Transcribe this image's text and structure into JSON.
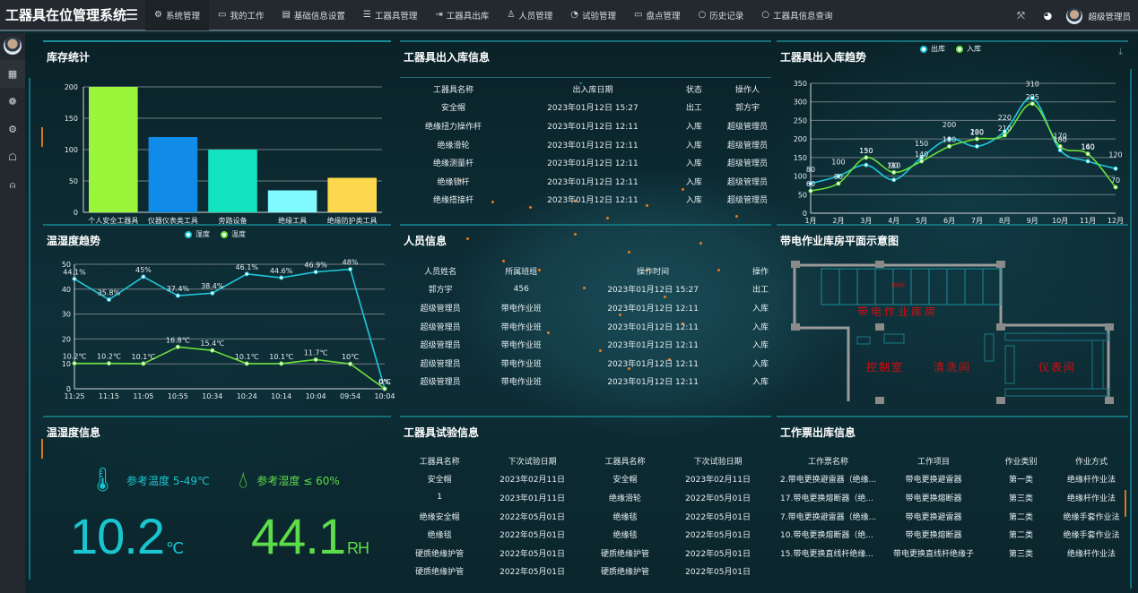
{
  "header": {
    "app_title": "工器具在位管理系统",
    "menu_icon": "hamburger-icon",
    "nav": [
      {
        "label": "系统管理",
        "icon": "gear-icon",
        "active": true
      },
      {
        "label": "我的工作",
        "icon": "monitor-icon"
      },
      {
        "label": "基础信息设置",
        "icon": "document-icon"
      },
      {
        "label": "工器具管理",
        "icon": "list-icon"
      },
      {
        "label": "工器具出库",
        "icon": "sign-out-icon"
      },
      {
        "label": "人员管理",
        "icon": "users-icon"
      },
      {
        "label": "试验管理",
        "icon": "dashboard-icon"
      },
      {
        "label": "盘点管理",
        "icon": "monitor-icon"
      },
      {
        "label": "历史记录",
        "icon": "circle-icon"
      },
      {
        "label": "工器具信息查询",
        "icon": "circle-icon"
      }
    ],
    "right_icons": [
      "fullscreen-icon",
      "theme-icon"
    ],
    "user_name": "超级管理员"
  },
  "sidebar": {
    "icons": [
      "grid-icon",
      "brain-icon",
      "gear-icon",
      "ghost-icon",
      "user-card-icon"
    ]
  },
  "inventory": {
    "title": "库存统计"
  },
  "io_table": {
    "title": "工器具出入库信息",
    "columns": [
      "工器具名称",
      "出入库日期",
      "状态",
      "操作人"
    ],
    "rows": [
      [
        "安全帽",
        "2023年01月12日 15:27",
        "出工",
        "郭方宇"
      ],
      [
        "绝缘扭力操作杆",
        "2023年01月12日 12:11",
        "入库",
        "超级管理员"
      ],
      [
        "绝缘滑轮",
        "2023年01月12日 12:11",
        "入库",
        "超级管理员"
      ],
      [
        "绝缘测量杆",
        "2023年01月12日 12:11",
        "入库",
        "超级管理员"
      ],
      [
        "绝缘锁杆",
        "2023年01月12日 12:11",
        "入库",
        "超级管理员"
      ],
      [
        "绝缘搭接杆",
        "2023年01月12日 12:11",
        "入库",
        "超级管理员"
      ]
    ]
  },
  "io_trend": {
    "title": "工器具出入库趋势"
  },
  "humidity_trend": {
    "title": "温湿度趋势"
  },
  "personnel": {
    "title": "人员信息",
    "columns": [
      "人员姓名",
      "所属班组",
      "操作时间",
      "操作"
    ],
    "rows": [
      [
        "郭方宇",
        "456",
        "2023年01月12日 15:27",
        "出工"
      ],
      [
        "超级管理员",
        "带电作业班",
        "2023年01月12日 12:11",
        "入库"
      ],
      [
        "超级管理员",
        "带电作业班",
        "2023年01月12日 12:11",
        "入库"
      ],
      [
        "超级管理员",
        "带电作业班",
        "2023年01月12日 12:11",
        "入库"
      ],
      [
        "超级管理员",
        "带电作业班",
        "2023年01月12日 12:11",
        "入库"
      ],
      [
        "超级管理员",
        "带电作业班",
        "2023年01月12日 12:11",
        "入库"
      ]
    ]
  },
  "floorplan": {
    "title": "带电作业库房平面示意图",
    "rooms": {
      "warehouse": "带电作业库房",
      "cabinet": "智能柜",
      "control": "控制室",
      "wash": "清洗间",
      "instrument": "仪表间"
    }
  },
  "env_info": {
    "title": "温湿度信息",
    "temp_ref": "参考温度 5-49℃",
    "humidity_ref": "参考湿度 ≤ 60%",
    "temp_value": "10.2",
    "temp_unit": "℃",
    "humidity_value": "44.1",
    "humidity_unit": "RH",
    "colors": {
      "temp": "#19c6d0",
      "humidity": "#5ddc4a"
    }
  },
  "test_info": {
    "title": "工器具试验信息",
    "columns": [
      "工器具名称",
      "下次试验日期",
      "工器具名称",
      "下次试验日期"
    ],
    "rows": [
      [
        "安全帽",
        "2023年02月11日",
        "安全帽",
        "2023年02月11日"
      ],
      [
        "1",
        "2023年01月11日",
        "绝缘滑轮",
        "2022年05月01日"
      ],
      [
        "绝缘安全帽",
        "2022年05月01日",
        "绝缘毯",
        "2022年05月01日"
      ],
      [
        "绝缘毯",
        "2022年05月01日",
        "绝缘毯",
        "2022年05月01日"
      ],
      [
        "硬质绝缘护管",
        "2022年05月01日",
        "硬质绝缘护管",
        "2022年05月01日"
      ],
      [
        "硬质绝缘护管",
        "2022年05月01日",
        "硬质绝缘护管",
        "2022年05月01日"
      ]
    ]
  },
  "work_tickets": {
    "title": "工作票出库信息",
    "columns": [
      "工作票名称",
      "工作项目",
      "作业类别",
      "作业方式"
    ],
    "rows": [
      [
        "2.带电更换避雷器（绝缘...",
        "带电更换避雷器",
        "第一类",
        "绝缘杆作业法"
      ],
      [
        "17.带电更换熔断器（绝...",
        "带电更换熔断器",
        "第三类",
        "绝缘杆作业法"
      ],
      [
        "7.带电更换避雷器（绝缘...",
        "带电更换避雷器",
        "第二类",
        "绝缘手套作业法"
      ],
      [
        "10.带电更换熔断器（绝...",
        "带电更换熔断器",
        "第二类",
        "绝缘手套作业法"
      ],
      [
        "15.带电更换直线杆绝缘...",
        "带电更换直线杆绝缘子",
        "第三类",
        "绝缘杆作业法"
      ]
    ]
  },
  "chart_data": [
    {
      "id": "inventory",
      "type": "bar",
      "title": "库存统计",
      "categories": [
        "个人安全工器具",
        "仪器仪表类工具",
        "旁路设备",
        "绝缘工具",
        "绝缘防护类工具"
      ],
      "values": [
        200,
        120,
        100,
        35,
        55
      ],
      "colors": [
        "#9bf53a",
        "#108ce8",
        "#12e2be",
        "#7ffafe",
        "#fed84c"
      ],
      "ylim": [
        0,
        200
      ],
      "yticks": [
        0,
        50,
        100,
        150,
        200
      ],
      "grid": true
    },
    {
      "id": "io_trend",
      "type": "line",
      "title": "工器具出入库趋势",
      "categories": [
        "1月",
        "2月",
        "3月",
        "4月",
        "5月",
        "6月",
        "7月",
        "8月",
        "9月",
        "10月",
        "11月",
        "12月"
      ],
      "series": [
        {
          "name": "出库",
          "color": "#1ec8dc",
          "values": [
            80,
            100,
            130,
            90,
            150,
            200,
            180,
            220,
            310,
            170,
            140,
            120
          ]
        },
        {
          "name": "入库",
          "color": "#6ae03a",
          "values": [
            60,
            80,
            150,
            110,
            140,
            180,
            200,
            210,
            295,
            180,
            160,
            70
          ]
        }
      ],
      "ylim": [
        0,
        350
      ],
      "yticks": [
        0,
        50,
        100,
        150,
        200,
        250,
        300,
        350
      ],
      "smooth": true,
      "legend": "top-center",
      "grid": true
    },
    {
      "id": "humidity_trend",
      "type": "line",
      "title": "温湿度趋势",
      "categories": [
        "11:25",
        "11:15",
        "11:05",
        "10:55",
        "10:34",
        "10:24",
        "10:14",
        "10:04",
        "09:54",
        "10:04"
      ],
      "series": [
        {
          "name": "湿度",
          "color": "#1ec8dc",
          "values": [
            44.1,
            35.8,
            45,
            37.4,
            38.4,
            46.1,
            44.6,
            46.9,
            48,
            0
          ],
          "labels": [
            "44.1%",
            "35.8%",
            "45%",
            "37.4%",
            "38.4%",
            "46.1%",
            "44.6%",
            "46.9%",
            "48%",
            "0%"
          ]
        },
        {
          "name": "温度",
          "color": "#6ae03a",
          "values": [
            10.2,
            10.2,
            10.1,
            16.8,
            15.4,
            10.1,
            10.1,
            11.7,
            10,
            0
          ],
          "labels": [
            "10.2℃",
            "10.2℃",
            "10.1℃",
            "16.8℃",
            "15.4℃",
            "10.1℃",
            "10.1℃",
            "11.7℃",
            "10℃",
            "0℃"
          ]
        }
      ],
      "ylim": [
        0,
        50
      ],
      "yticks": [
        0,
        10,
        20,
        30,
        40,
        50
      ],
      "legend": "top-center",
      "grid": true
    }
  ]
}
